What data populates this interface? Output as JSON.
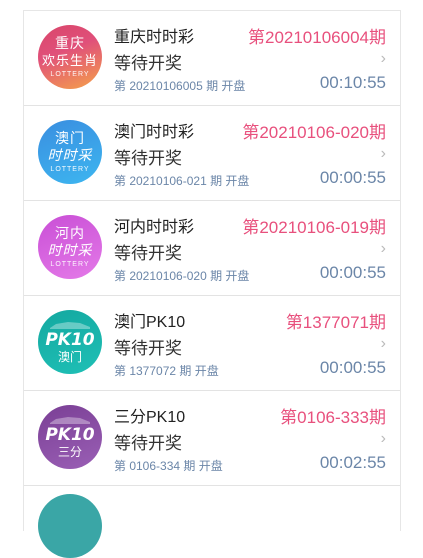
{
  "lotteries": [
    {
      "name": "重庆时时彩",
      "status": "等待开奖",
      "period": "第20210106004期",
      "next_draw": "第 20210106005 期 开盘",
      "countdown": "00:10:55",
      "logo": {
        "line1": "重庆",
        "line2": "欢乐生肖",
        "line3": "LOTTERY",
        "color_top": "#d9456a",
        "color_bottom": "#f5a24a"
      }
    },
    {
      "name": "澳门时时彩",
      "status": "等待开奖",
      "period": "第20210106-020期",
      "next_draw": "第 20210106-021 期 开盘",
      "countdown": "00:00:55",
      "logo": {
        "line1": "澳门",
        "line2": "时时采",
        "line3": "LOTTERY",
        "color_top": "#3a8ee0",
        "color_bottom": "#3db6f0"
      }
    },
    {
      "name": "河内时时彩",
      "status": "等待开奖",
      "period": "第20210106-019期",
      "next_draw": "第 20210106-020 期 开盘",
      "countdown": "00:00:55",
      "logo": {
        "line1": "河内",
        "line2": "时时采",
        "line3": "LOTTERY",
        "color_top": "#c94fd6",
        "color_bottom": "#e47ae8"
      }
    },
    {
      "name": "澳门PK10",
      "status": "等待开奖",
      "period": "第1377071期",
      "next_draw": "第 1377072 期 开盘",
      "countdown": "00:00:55",
      "logo": {
        "badge": "PK10",
        "sub": "澳门",
        "color_top": "#14a8a0",
        "color_bottom": "#1fc0b6"
      }
    },
    {
      "name": "三分PK10",
      "status": "等待开奖",
      "period": "第0106-333期",
      "next_draw": "第 0106-334 期 开盘",
      "countdown": "00:02:55",
      "logo": {
        "badge": "PK10",
        "sub": "三分",
        "color_top": "#7a3f95",
        "color_bottom": "#9a5fb5"
      }
    }
  ],
  "chevron": "›",
  "peek_logo_color": "#3aa6a6"
}
